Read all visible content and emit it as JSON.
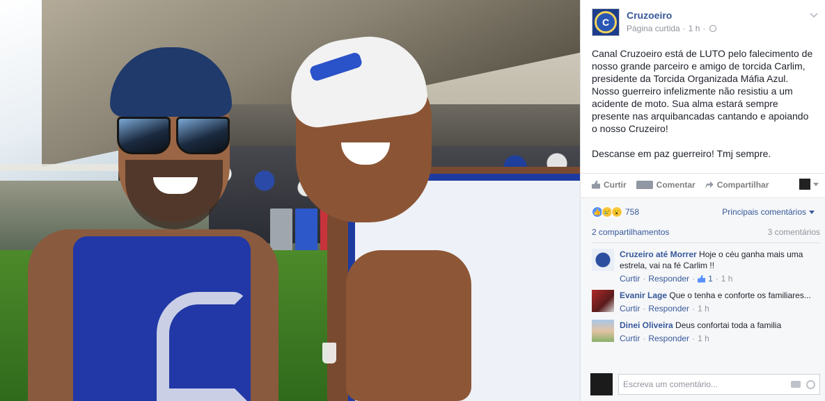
{
  "post": {
    "page_name": "Cruzoeiro",
    "meta_label": "Página curtida",
    "time": "1 h",
    "text": "Canal Cruzoeiro está de LUTO pelo falecimento de nosso grande parceiro e amigo de torcida Carlim, presidente da Torcida Organizada Máfia Azul. Nosso guerreiro infelizmente não resistiu a um acidente de moto. Sua alma estará sempre presente nas arquibancadas cantando e apoiando o nosso Cruzeiro!\n\nDescanse em paz guerreiro! Tmj sempre."
  },
  "actions": {
    "like": "Curtir",
    "comment": "Comentar",
    "share": "Compartilhar"
  },
  "reactions": {
    "count": "758",
    "sort_label": "Principais comentários"
  },
  "stats": {
    "shares": "2 compartilhamentos",
    "comments": "3 comentários"
  },
  "comments": [
    {
      "author": "Cruzeiro até Morrer",
      "text": "Hoje o céu ganha mais uma estrela, vai na fé Carlim !!",
      "like": "Curtir",
      "reply": "Responder",
      "likes": "1",
      "time": "1 h"
    },
    {
      "author": "Evanir Lage",
      "text": "Que o tenha e conforte os familiares...",
      "like": "Curtir",
      "reply": "Responder",
      "time": "1 h"
    },
    {
      "author": "Dinei Oliveira",
      "text": "Deus confortai toda a familia",
      "like": "Curtir",
      "reply": "Responder",
      "time": "1 h"
    }
  ],
  "composer": {
    "placeholder": "Escreva um comentário..."
  },
  "colors": {
    "link": "#365899",
    "muted": "#90949c",
    "feedback_bg": "#f6f7f9",
    "team_blue": "#1d3aa0"
  }
}
